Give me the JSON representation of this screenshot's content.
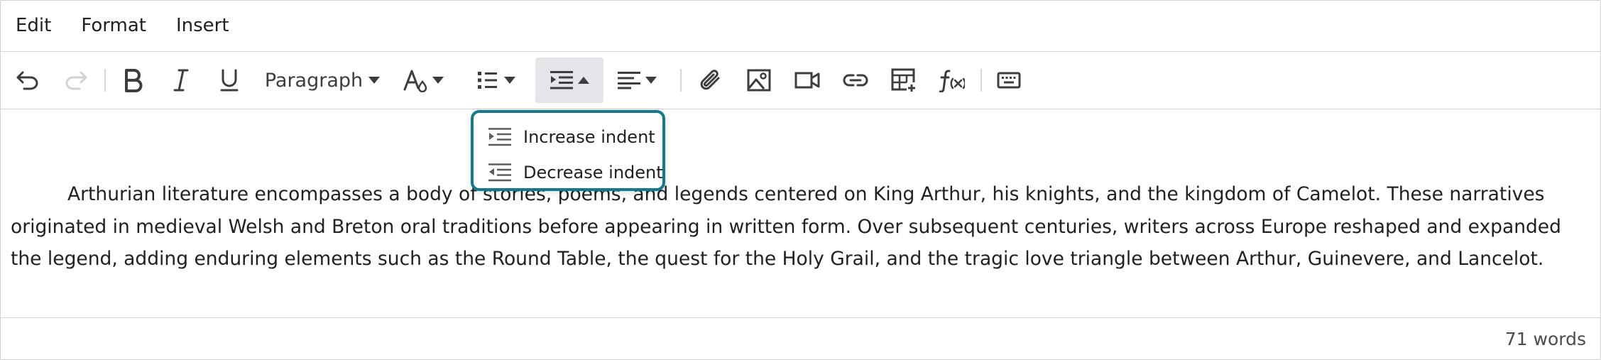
{
  "menubar": {
    "items": [
      {
        "label": "Edit"
      },
      {
        "label": "Format"
      },
      {
        "label": "Insert"
      }
    ]
  },
  "toolbar": {
    "buttons": [
      {
        "icon": "undo-icon"
      },
      {
        "icon": "redo-icon"
      },
      {
        "icon": "bold-icon"
      },
      {
        "icon": "italic-icon"
      },
      {
        "icon": "underline-icon"
      },
      {
        "icon": "text-color-icon"
      },
      {
        "icon": "bullet-list-icon"
      },
      {
        "icon": "indent-icon"
      },
      {
        "icon": "align-icon"
      },
      {
        "icon": "attachment-icon"
      },
      {
        "icon": "image-icon"
      },
      {
        "icon": "video-icon"
      },
      {
        "icon": "link-icon"
      },
      {
        "icon": "table-icon"
      },
      {
        "icon": "equation-icon"
      },
      {
        "icon": "keyboard-icon"
      }
    ],
    "paragraph_label": "Paragraph"
  },
  "indent_menu": {
    "items": [
      {
        "label": "Increase indent",
        "icon": "increase-indent-icon"
      },
      {
        "label": "Decrease indent",
        "icon": "decrease-indent-icon"
      }
    ]
  },
  "content": {
    "paragraph": "Arthurian literature encompasses a body of stories, poems, and legends centered on King Arthur, his knights, and the kingdom of Camelot. These narratives originated in medieval Welsh and Breton oral traditions before appearing in written form. Over subsequent centuries, writers across Europe reshaped and expanded the legend, adding enduring elements such as the Round Table, the quest for the Holy Grail, and the tragic love triangle between Arthur, Guinevere, and Lancelot."
  },
  "status": {
    "word_count": "71 words"
  },
  "colors": {
    "focus_ring": "#127a8a",
    "active_button_bg": "#e3e5e8",
    "text": "#202122"
  }
}
